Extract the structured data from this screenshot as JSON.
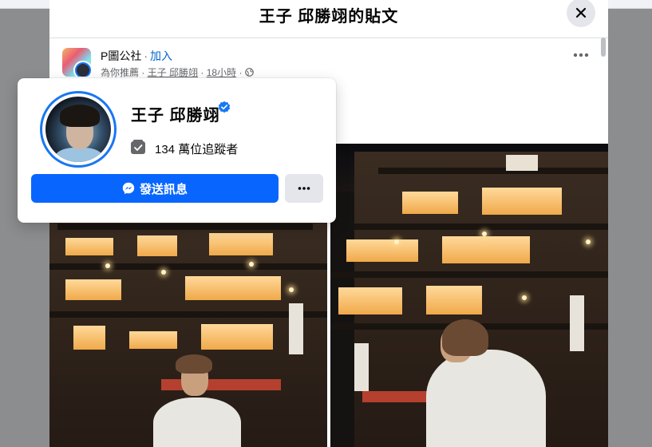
{
  "dialog": {
    "title": "王子 邱勝翊的貼文",
    "close_icon": "close-icon"
  },
  "post": {
    "group_name": "P圖公社",
    "separator": "·",
    "join_label": "加入",
    "recommended_label": "為你推薦",
    "author": "王子 邱勝翊",
    "time": "18小時",
    "privacy_icon": "globe-icon",
    "more_icon": "more-horizontal-icon"
  },
  "hover_card": {
    "name": "王子 邱勝翊",
    "verified_icon": "verified-badge-icon",
    "followers_icon": "followers-icon",
    "followers_text": "134 萬位追蹤者",
    "message_button": "發送訊息",
    "message_icon": "messenger-icon",
    "more_icon": "more-horizontal-icon"
  },
  "colors": {
    "accent": "#0866ff",
    "verified": "#1877f2",
    "link": "#0064d1",
    "secondary_text": "#65676b",
    "button_gray": "#e4e6eb"
  }
}
